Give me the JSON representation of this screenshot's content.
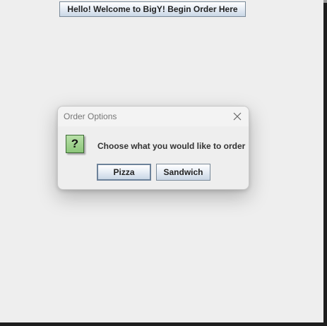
{
  "main": {
    "begin_button_label": "Hello! Welcome to BigY! Begin Order Here"
  },
  "dialog": {
    "title": "Order Options",
    "close_icon": "close-icon",
    "message_icon": "question-icon",
    "message_icon_glyph": "?",
    "message": "Choose what you would like to order",
    "buttons": [
      {
        "label": "Pizza",
        "focused": true
      },
      {
        "label": "Sandwich",
        "focused": false
      }
    ]
  },
  "colors": {
    "background": "#eeeeee",
    "button_gradient_bottom": "#c9d6e5",
    "question_icon_fill": "#8cc67a"
  }
}
